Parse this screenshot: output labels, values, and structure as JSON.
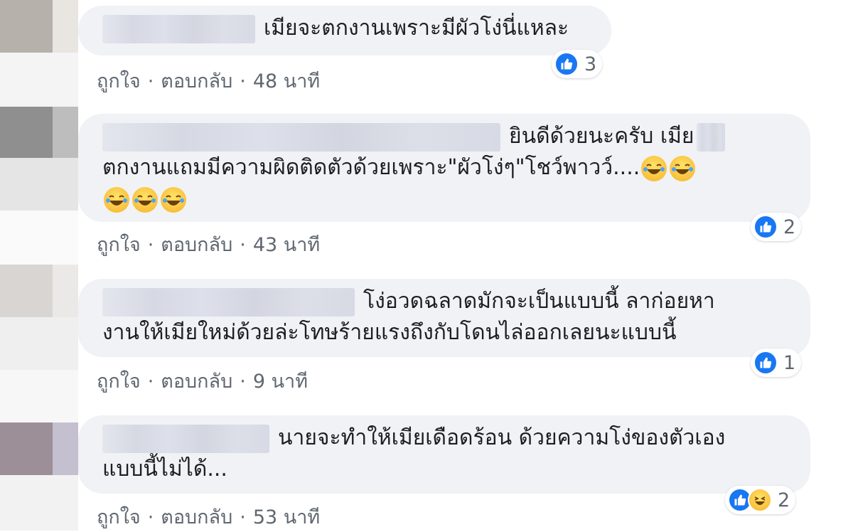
{
  "action_labels": {
    "like": "ถูกใจ",
    "reply": "ตอบกลับ",
    "separator": "·"
  },
  "colors": {
    "bubble": "#f0f2f5",
    "like_blue": "#1877f2",
    "meta_text": "#606770"
  },
  "comments": [
    {
      "text_line1": "เมียจะตกงานเพราะมีผัวโง่นี่แหละ",
      "time": "48 นาที",
      "reactions": {
        "types": [
          "like-icon"
        ],
        "count": "3"
      }
    },
    {
      "text_line1": "ยินดีด้วยนะครับ เมีย",
      "text_line2": "ตกงานแถมมีความผิดติดตัวด้วยเพราะ\"ผัวโง่ๆ\"โชว์พาวว์....",
      "emoji_name": "laughing-crying-emoji",
      "time": "43 นาที",
      "reactions": {
        "types": [
          "like-icon"
        ],
        "count": "2"
      }
    },
    {
      "text_line1": "โง่อวดฉลาดมักจะเป็นแบบนี้ ลาก่อยหา",
      "text_line2": "งานให้เมียใหม่ด้วยล่ะโทษร้ายแรงถึงกับโดนไล่ออกเลยนะแบบนี้",
      "time": "9 นาที",
      "reactions": {
        "types": [
          "like-icon"
        ],
        "count": "1"
      }
    },
    {
      "text_line1": "นายจะทำให้เมียเดือดร้อน ด้วยความโง่ของตัวเอง",
      "text_line2": "แบบนี้ไม่ได้...",
      "time": "53 นาที",
      "reactions": {
        "types": [
          "like-icon",
          "haha-icon"
        ],
        "count": "2"
      }
    }
  ]
}
